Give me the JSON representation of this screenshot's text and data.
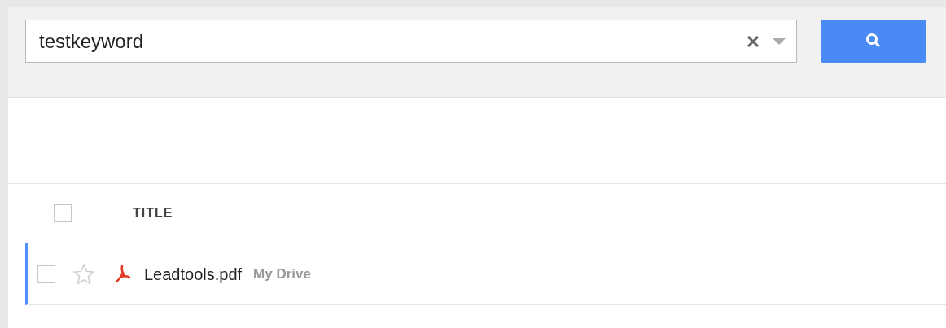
{
  "search": {
    "value": "testkeyword"
  },
  "table": {
    "header": {
      "checked": false,
      "title": "TITLE"
    },
    "rows": [
      {
        "title": "Leadtools.pdf",
        "location": "My Drive",
        "checked": false,
        "starred": false,
        "selected": true
      }
    ]
  }
}
